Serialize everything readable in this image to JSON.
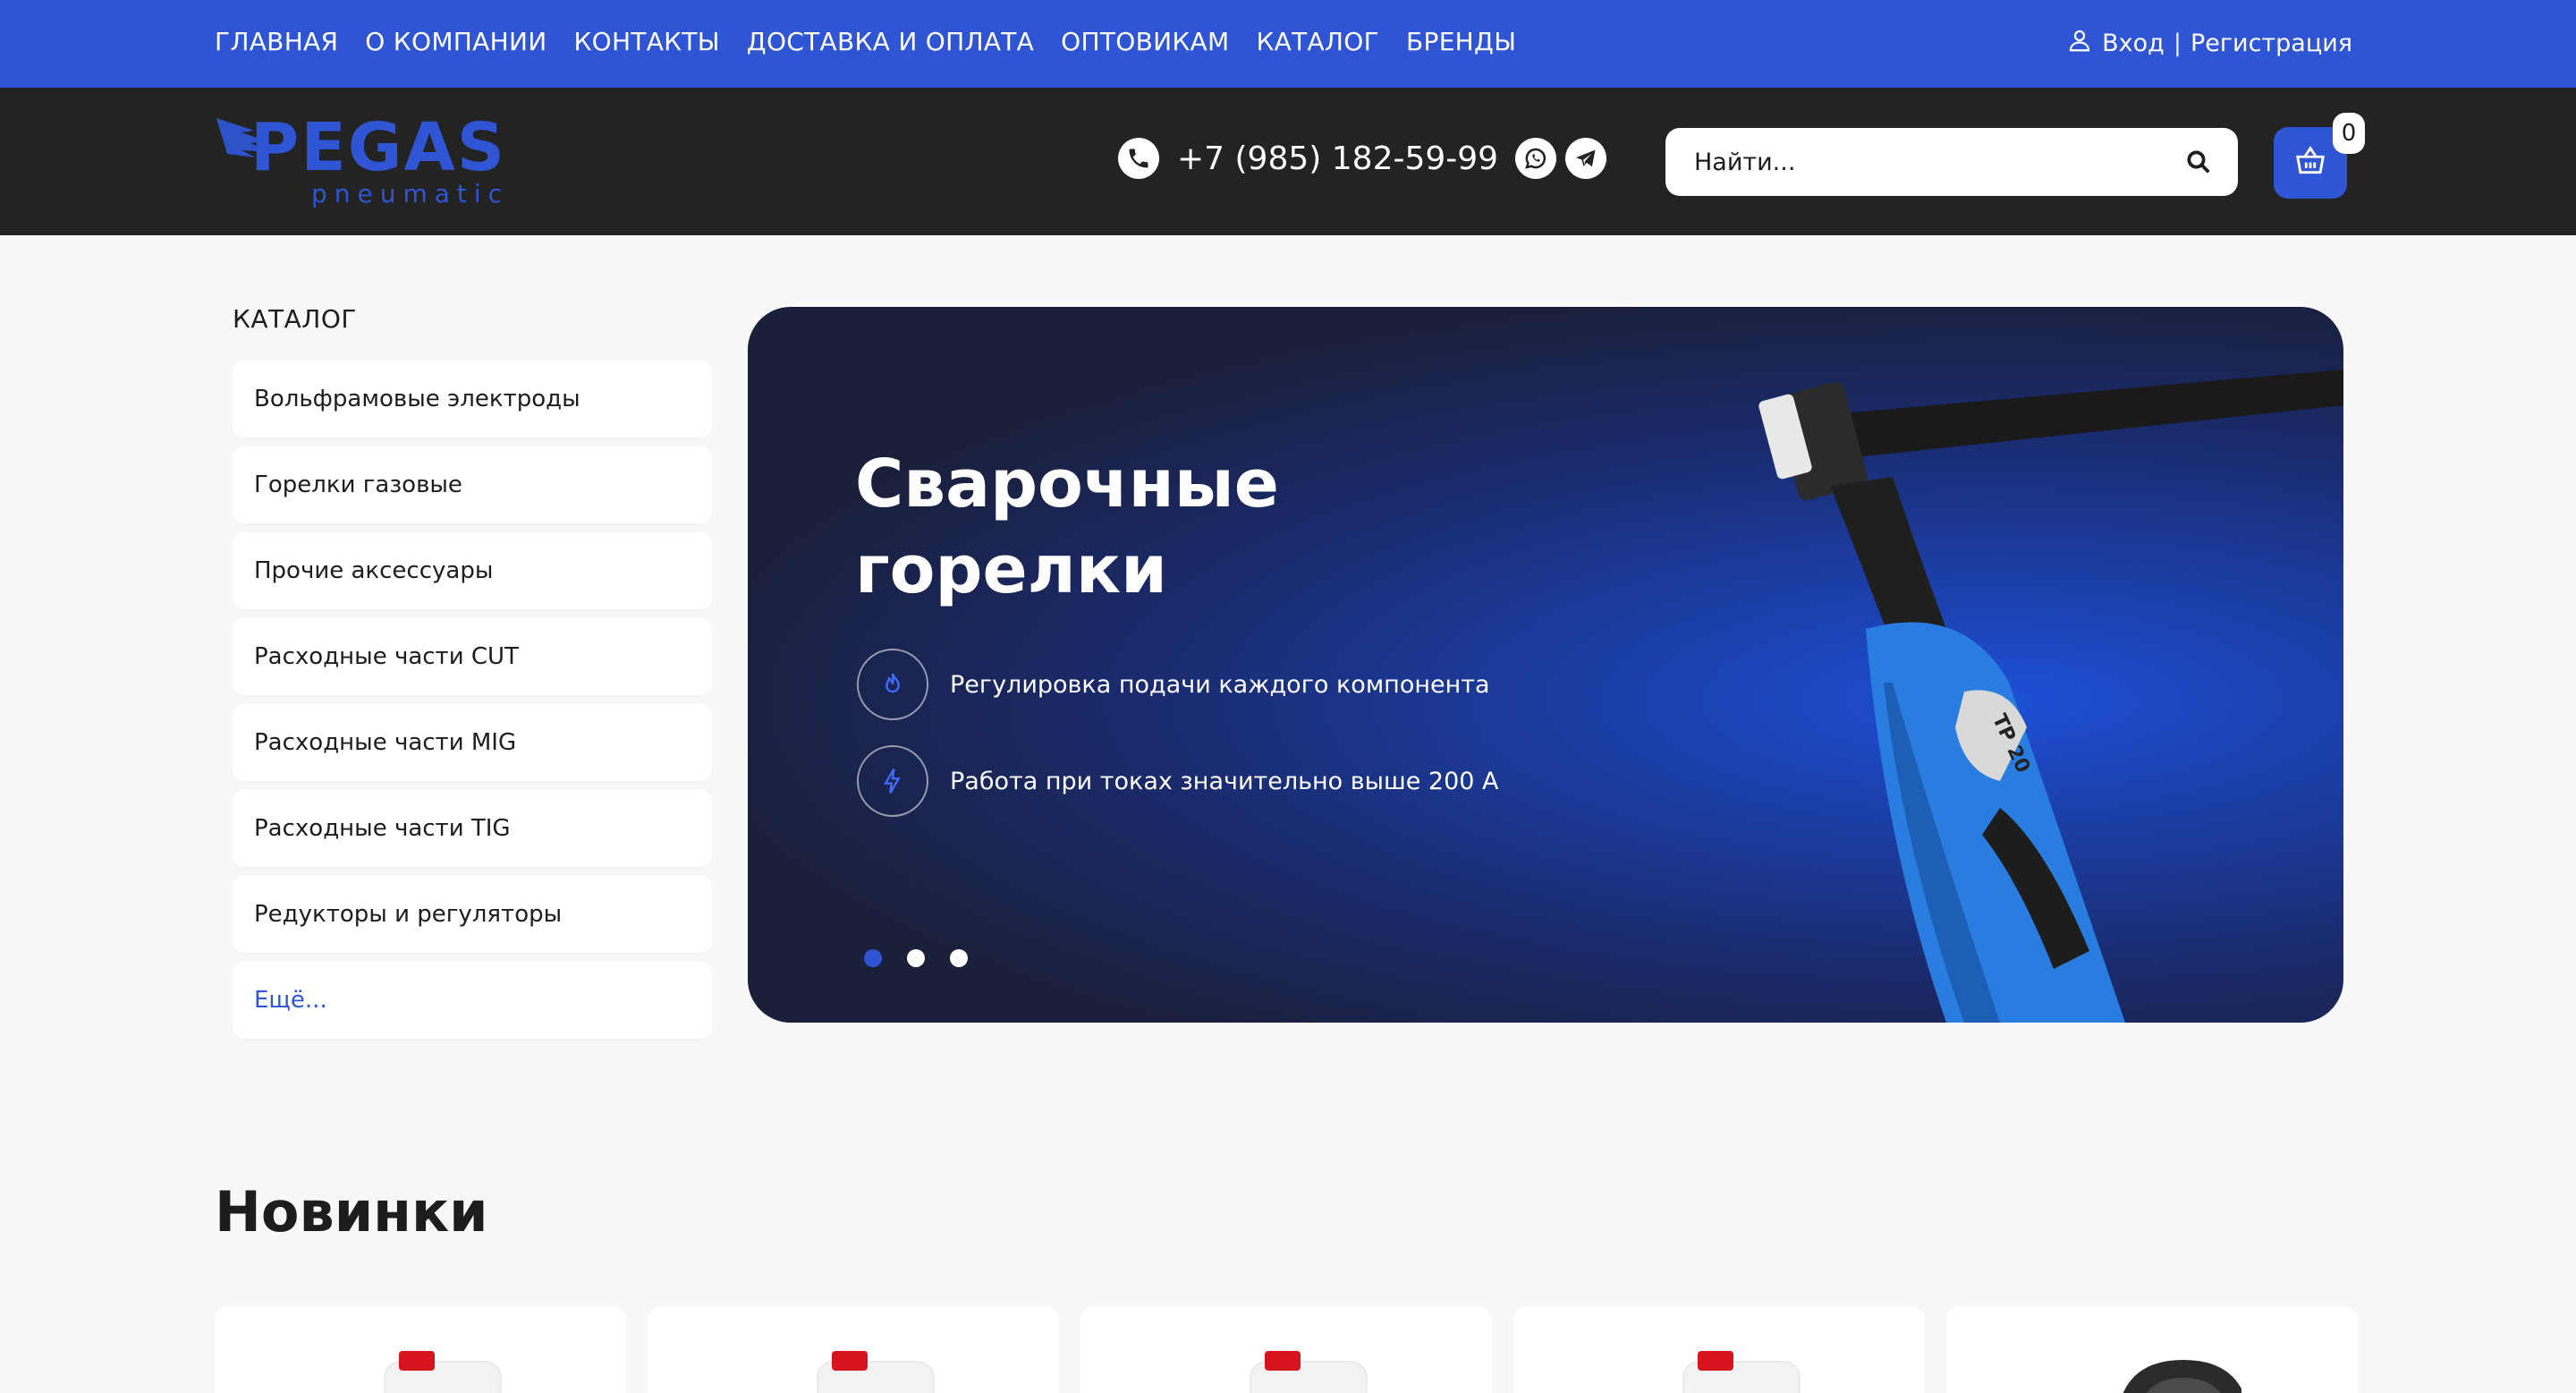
{
  "nav": {
    "items": [
      "ГЛАВНАЯ",
      "О КОМПАНИИ",
      "КОНТАКТЫ",
      "ДОСТАВКА И ОПЛАТА",
      "ОПТОВИКАМ",
      "КАТАЛОГ",
      "БРЕНДЫ"
    ],
    "login": "Вход",
    "separator": "|",
    "register": "Регистрация"
  },
  "header": {
    "logo_main": "PEGAS",
    "logo_sub": "pneumatic",
    "phone": "+7 (985) 182-59-99",
    "search_placeholder": "Найти...",
    "cart_count": "0"
  },
  "catalog": {
    "title": "КАТАЛОГ",
    "items": [
      "Вольфрамовые электроды",
      "Горелки газовые",
      "Прочие аксессуары",
      "Расходные части CUT",
      "Расходные части MIG",
      "Расходные части TIG",
      "Редукторы и регуляторы"
    ],
    "more": "Ещё..."
  },
  "banner": {
    "title": "Сварочные горелки",
    "features": [
      {
        "icon": "flame-icon",
        "text": "Регулировка подачи каждого компонента"
      },
      {
        "icon": "lightning-icon",
        "text": "Работа при токах значительно выше 200 А"
      }
    ],
    "product_label": "TP 20",
    "slides_count": 3,
    "active_slide": 1
  },
  "new_section": {
    "title": "Новинки",
    "cards_count": 5
  },
  "colors": {
    "brand_blue": "#2f55d4",
    "header_dark": "#232323",
    "page_bg": "#f8f8f8"
  }
}
